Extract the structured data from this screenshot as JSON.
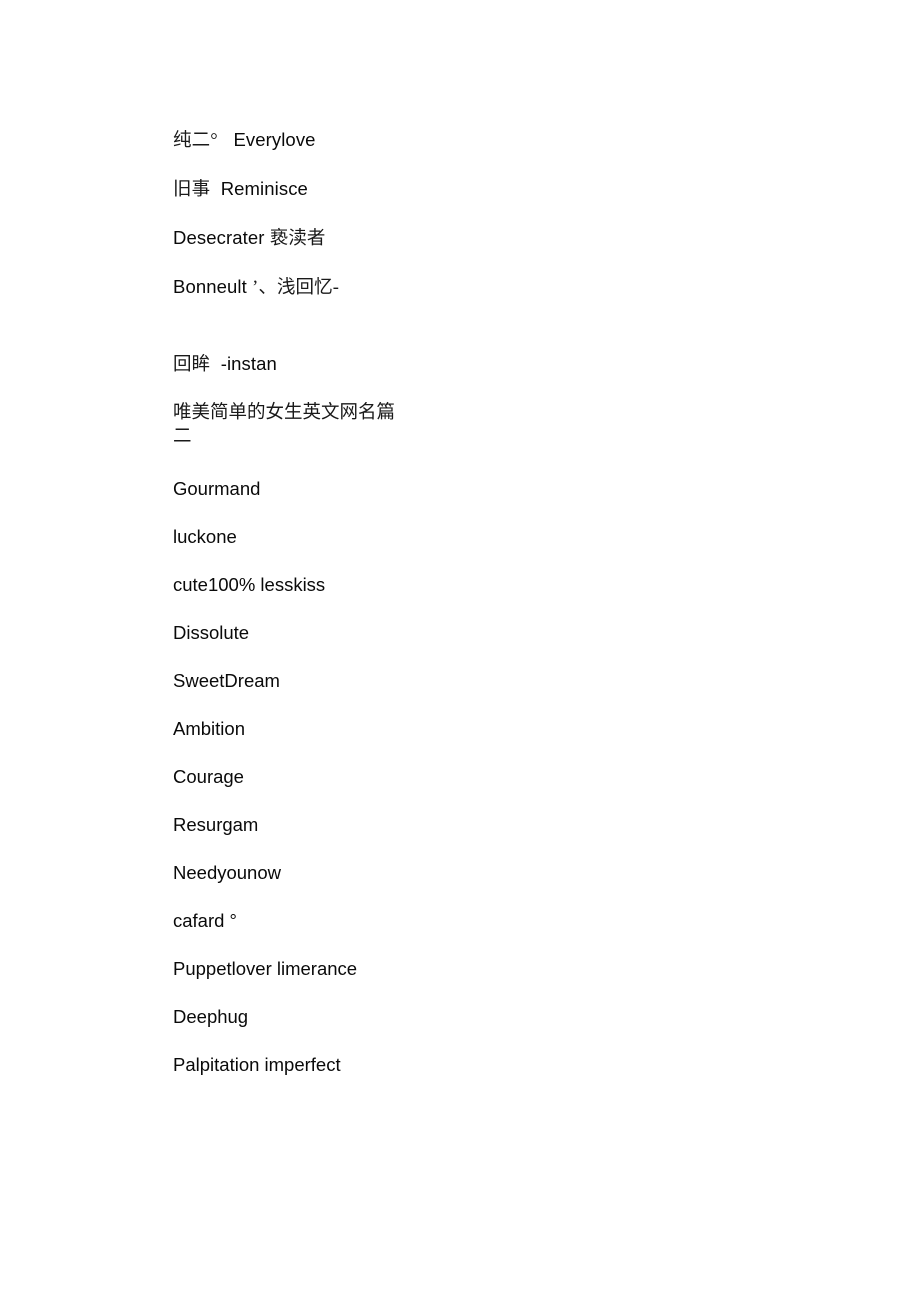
{
  "document": {
    "group_one": [
      {
        "cjk": "纯二°",
        "sep": "   ",
        "latin": "Everylove"
      },
      {
        "cjk": "旧事",
        "sep": "  ",
        "latin": "Reminisce"
      },
      {
        "latin": "Desecrater ",
        "sep": "",
        "cjk": "亵渎者"
      },
      {
        "latin": "Bonneult ",
        "sep": "",
        "cjk": "’、浅回忆-"
      },
      {
        "cjk": "回眸",
        "sep": "  ",
        "latin": "-instan"
      }
    ],
    "heading": "唯美简单的女生英文网名篇二",
    "group_two": [
      "Gourmand",
      "luckone",
      "cute100% lesskiss",
      "Dissolute",
      "SweetDream",
      "Ambition",
      "Courage",
      "Resurgam",
      "Needyounow",
      "cafard °",
      "Puppetlover limerance",
      "Deephug",
      "Palpitation imperfect"
    ]
  }
}
